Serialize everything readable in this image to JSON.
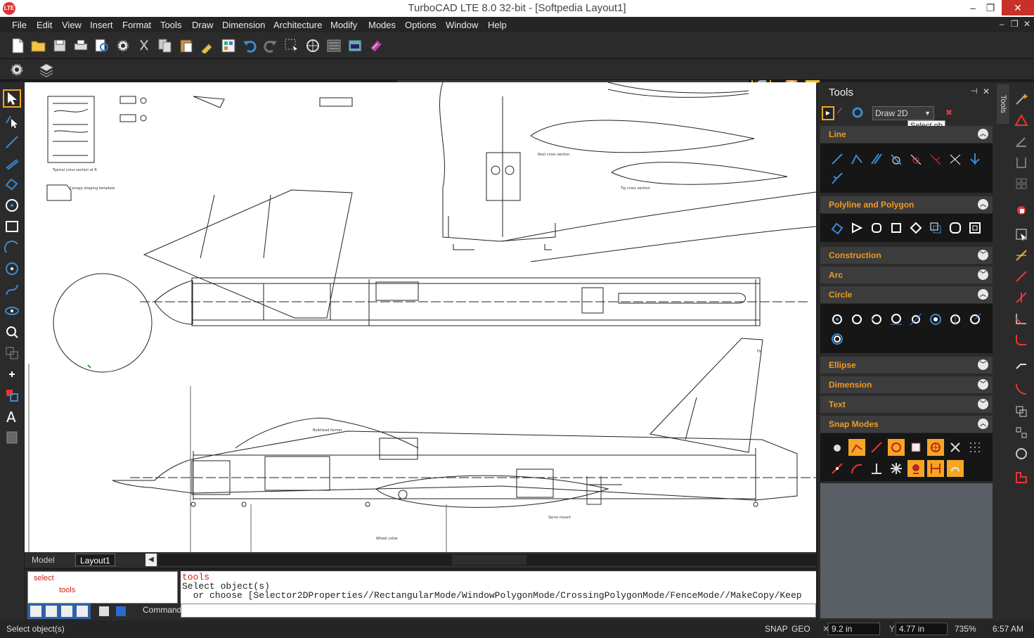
{
  "window": {
    "title": "TurboCAD LTE 8.0 32-bit - [Softpedia Layout1]",
    "app_icon": "LTE",
    "minimize": "–",
    "restore": "❐",
    "close": "✕"
  },
  "menu": {
    "items": [
      "File",
      "Edit",
      "View",
      "Insert",
      "Format",
      "Tools",
      "Draw",
      "Dimension",
      "Architecture",
      "Modify",
      "Modes",
      "Options",
      "Window",
      "Help"
    ],
    "mdi_min": "–",
    "mdi_restore": "❐",
    "mdi_close": "✕"
  },
  "tabs": {
    "model": "Model",
    "layout": "Layout1"
  },
  "command": {
    "tree_root": "select",
    "tree_child": "tools",
    "line1": "tools",
    "line2": "Select object(s)",
    "line3": "  or choose [Selector2DProperties//RectangularMode/WindowPolygonMode/CrossingPolygonMode/FenceMode//MakeCopy/Keep",
    "label": "Command:"
  },
  "status": {
    "message": "Select object(s)",
    "snap": "SNAP",
    "geo": "GEO",
    "x": "9.2 in",
    "y": "4.77 in",
    "zoom": "735%",
    "time": "6:57 AM"
  },
  "tools_panel": {
    "title": "Tools",
    "pin": "⊣",
    "close": "✕",
    "mode_select": "Draw 2D",
    "tooltip": "Select ob",
    "vertical_tab": "Tools",
    "sections": [
      {
        "name": "Line",
        "expanded": true
      },
      {
        "name": "Polyline and Polygon",
        "expanded": true
      },
      {
        "name": "Construction",
        "expanded": false
      },
      {
        "name": "Arc",
        "expanded": false
      },
      {
        "name": "Circle",
        "expanded": true
      },
      {
        "name": "Ellipse",
        "expanded": false
      },
      {
        "name": "Dimension",
        "expanded": false
      },
      {
        "name": "Text",
        "expanded": false
      },
      {
        "name": "Snap Modes",
        "expanded": true
      }
    ]
  },
  "drawing_labels": {
    "profile_note": "Typical cross section at R",
    "canopy_note": "Canopy shaping template",
    "balsa_tip": "Root cross section",
    "tip_section": "Tip cross section",
    "fin_label": "Fin",
    "former_note": "Bulkhead former",
    "servo_note": "Servo mount",
    "wheel_note": "Wheel collar"
  },
  "colors": {
    "accent": "#f5a623",
    "panel_bg": "#2b2b2b",
    "section_header": "#3c3c3c",
    "section_text": "#f39a1e",
    "close_red": "#c7312a"
  }
}
